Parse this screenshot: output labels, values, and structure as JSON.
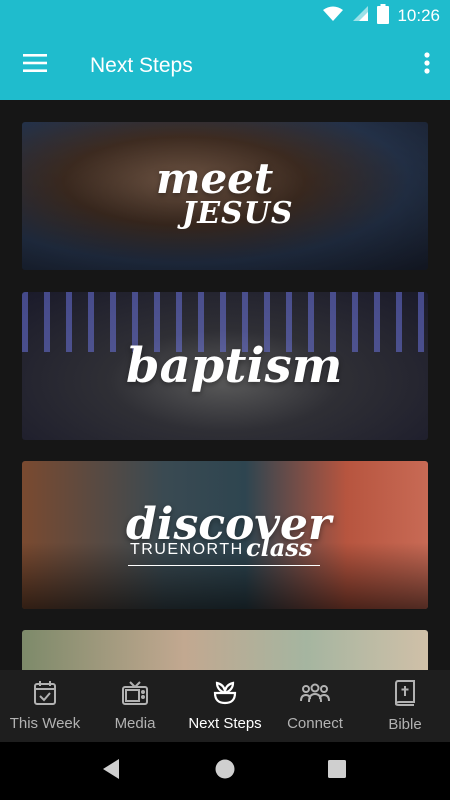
{
  "status_bar": {
    "time": "10:26",
    "icons": [
      "wifi-icon",
      "signal-icon",
      "battery-icon"
    ]
  },
  "app_bar": {
    "title": "Next Steps",
    "menu_icon": "hamburger-menu-icon",
    "more_icon": "more-vert-icon",
    "color": "#1fbccd"
  },
  "cards": [
    {
      "title": "meet",
      "subtitle": "JESUS"
    },
    {
      "title": "baptism"
    },
    {
      "title": "discover",
      "subtitle_left": "TRUENORTH",
      "subtitle_right": "class"
    },
    {
      "title": ""
    }
  ],
  "bottom_nav": {
    "items": [
      {
        "label": "This Week",
        "icon": "calendar-check-icon",
        "active": false
      },
      {
        "label": "Media",
        "icon": "tv-icon",
        "active": false
      },
      {
        "label": "Next Steps",
        "icon": "sprout-icon",
        "active": true
      },
      {
        "label": "Connect",
        "icon": "group-icon",
        "active": false
      },
      {
        "label": "Bible",
        "icon": "bible-icon",
        "active": false
      }
    ]
  },
  "system_nav": {
    "buttons": [
      "back-icon",
      "home-icon",
      "recents-icon"
    ]
  }
}
